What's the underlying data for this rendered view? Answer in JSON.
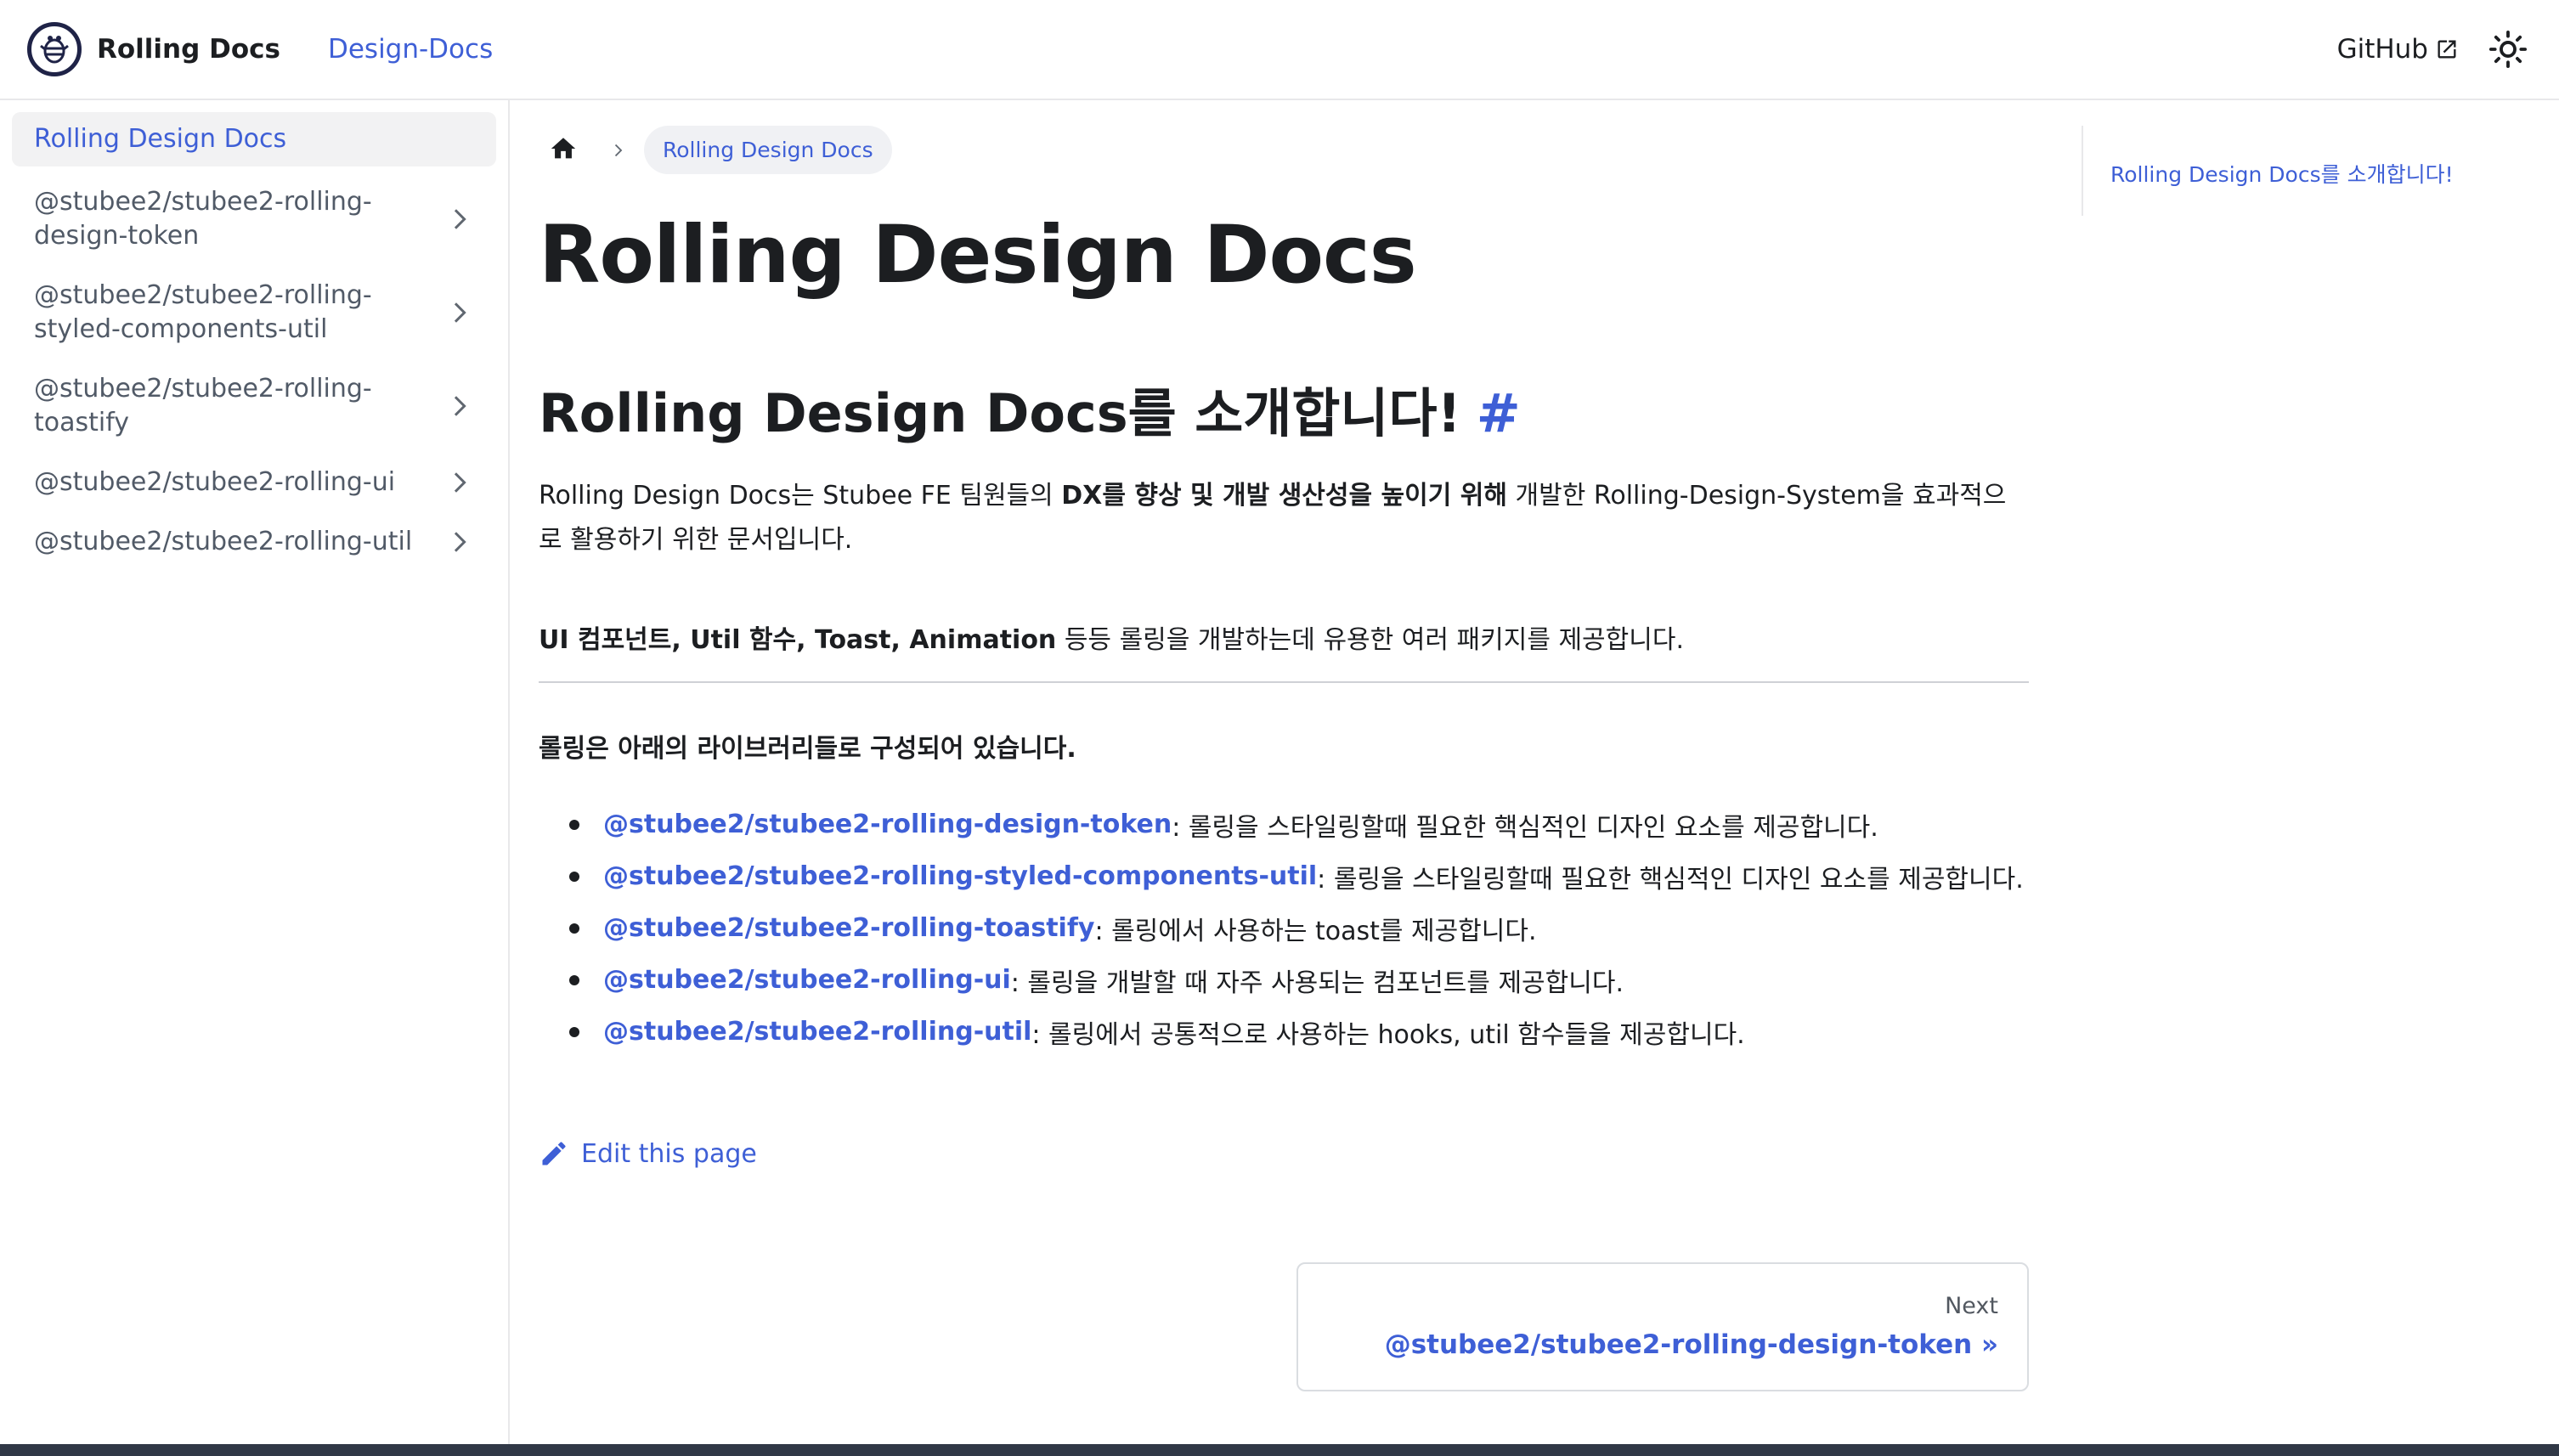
{
  "navbar": {
    "brand_title": "Rolling Docs",
    "nav_link": "Design-Docs",
    "github_label": "GitHub",
    "accent_color": "#3e5fd6"
  },
  "sidebar": {
    "items": [
      {
        "label": "Rolling Design Docs",
        "active": true
      },
      {
        "label": "@stubee2/stubee2-rolling-design-token"
      },
      {
        "label": "@stubee2/stubee2-rolling-styled-components-util"
      },
      {
        "label": "@stubee2/stubee2-rolling-toastify"
      },
      {
        "label": "@stubee2/stubee2-rolling-ui"
      },
      {
        "label": "@stubee2/stubee2-rolling-util"
      }
    ]
  },
  "breadcrumb": {
    "current": "Rolling Design Docs"
  },
  "main": {
    "title": "Rolling Design Docs",
    "section_title": "Rolling Design Docs를 소개합니다!",
    "hash": "#",
    "intro": {
      "before": "Rolling Design Docs는 Stubee FE 팀원들의 ",
      "bold": "DX를 향상 및 개발 생산성을 높이기 위해",
      "after": " 개발한 Rolling-Design-System을 효과적으로 활용하기 위한 문서입니다."
    },
    "features": {
      "bold": "UI 컴포넌트, Util 함수, Toast, Animation",
      "after": " 등등 롤링을 개발하는데 유용한 여러 패키지를 제공합니다."
    },
    "libraries_heading": "롤링은 아래의 라이브러리들로 구성되어 있습니다.",
    "libraries": [
      {
        "name": "@stubee2/stubee2-rolling-design-token",
        "desc": " : 롤링을 스타일링할때 필요한 핵심적인 디자인 요소를 제공합니다."
      },
      {
        "name": "@stubee2/stubee2-rolling-styled-components-util",
        "desc": " : 롤링을 스타일링할때 필요한 핵심적인 디자인 요소를 제공합니다."
      },
      {
        "name": "@stubee2/stubee2-rolling-toastify",
        "desc": " : 롤링에서 사용하는 toast를 제공합니다."
      },
      {
        "name": "@stubee2/stubee2-rolling-ui",
        "desc": " : 롤링을 개발할 때 자주 사용되는 컴포넌트를 제공합니다."
      },
      {
        "name": "@stubee2/stubee2-rolling-util",
        "desc": " : 롤링에서 공통적으로 사용하는 hooks, util 함수들을 제공합니다."
      }
    ],
    "edit_label": "Edit this page",
    "pager": {
      "sub_label": "Next",
      "label": "@stubee2/stubee2-rolling-design-token »"
    }
  },
  "toc": {
    "items": [
      {
        "label": "Rolling Design Docs를 소개합니다!"
      }
    ]
  }
}
